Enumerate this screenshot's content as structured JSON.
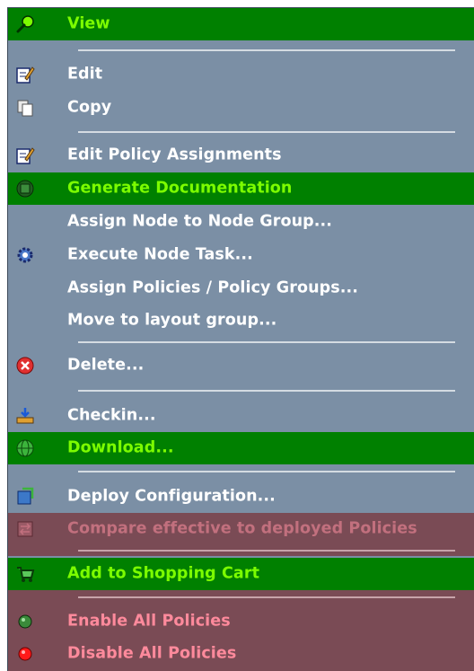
{
  "menu": {
    "view": "View",
    "edit": "Edit",
    "copy": "Copy",
    "edit_policy": "Edit Policy Assignments",
    "generate_doc": "Generate Documentation",
    "assign_node_group": "Assign Node to Node Group...",
    "execute_task": "Execute Node Task...",
    "assign_policies": "Assign Policies / Policy Groups...",
    "move_layout": "Move to layout group...",
    "delete": "Delete...",
    "checkin": "Checkin...",
    "download": "Download...",
    "deploy_config": "Deploy Configuration...",
    "compare": "Compare effective to deployed Policies",
    "add_cart": "Add to Shopping Cart",
    "enable_all": "Enable All Policies",
    "disable_all": "Disable All Policies"
  },
  "colors": {
    "menu_bg": "#7b8fa5",
    "highlight": "#008000",
    "highlight_text": "#7cfc00",
    "disabled_band": "#7a4b55",
    "separator": "#d4dbe2"
  },
  "icons": [
    "magnifier-icon",
    "edit-pencil-icon",
    "copy-icon",
    "edit-pencil-icon",
    "documentation-icon",
    "gear-icon",
    "delete-icon",
    "checkin-icon",
    "download-icon",
    "deploy-icon",
    "compare-icon",
    "shopping-cart-icon",
    "green-dot-icon",
    "red-dot-icon"
  ]
}
